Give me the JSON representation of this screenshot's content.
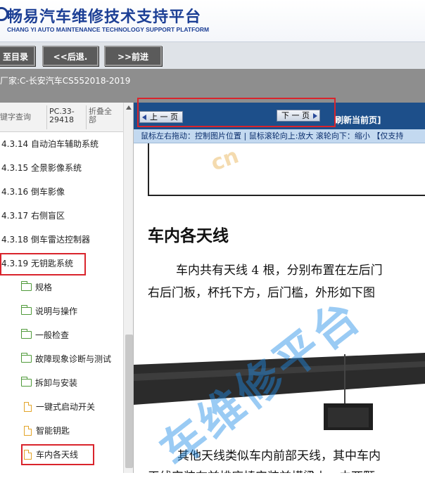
{
  "header": {
    "title": "畅易汽车维修技术支持平台",
    "subtitle": "CHANG YI AUTO MAINTENANCE TECHNOLOGY SUPPORT PLATFORM"
  },
  "nav": {
    "catalog_label": "至目录",
    "back_label": "<<后退.",
    "forward_label": ">>前进"
  },
  "manufacturer_bar": {
    "text": "厂家:C-长安汽车CS552018-2019"
  },
  "sidebar": {
    "columns": [
      "键字查询",
      "PC.33-29418",
      "折叠全部"
    ],
    "items": [
      {
        "label": "4.3.14 自动泊车辅助系统",
        "icon": "none"
      },
      {
        "label": "4.3.15 全景影像系统",
        "icon": "none"
      },
      {
        "label": "4.3.16 倒车影像",
        "icon": "none"
      },
      {
        "label": "4.3.17 右侧盲区",
        "icon": "none"
      },
      {
        "label": "4.3.18 倒车雷达控制器",
        "icon": "none"
      },
      {
        "label": "4.3.19 无钥匙系统",
        "icon": "none",
        "highlighted": true
      },
      {
        "label": "规格",
        "icon": "folder-icon"
      },
      {
        "label": "说明与操作",
        "icon": "folder-icon"
      },
      {
        "label": "一般检查",
        "icon": "folder-icon"
      },
      {
        "label": "故障现象诊断与测试",
        "icon": "folder-icon"
      },
      {
        "label": "拆卸与安装",
        "icon": "folder-open-icon"
      },
      {
        "label": "一键式启动开关",
        "icon": "document-icon"
      },
      {
        "label": "智能钥匙",
        "icon": "document-icon"
      },
      {
        "label": "车内各天线",
        "icon": "document-icon",
        "highlighted": true
      }
    ]
  },
  "viewer": {
    "prev_label": "上 一 页",
    "next_label": "下 一 页",
    "refresh_label": "刷新当前页]",
    "hint": "鼠标左右拖动：控制图片位置 | 鼠标滚轮向上:放大  滚轮向下：缩小 【仅支持",
    "heading": "车内各天线",
    "para1_line1": "车内共有天线 4 根，分别布置在左后门",
    "para1_line2": "右后门板，杯托下方，后门槛，外形如下图",
    "para2_line1": "其他天线类似车内前部天线，其中车内",
    "para2_line2": "天线安装在前排座椅安装前横梁上，由两颗",
    "watermark": "车维修平台",
    "watermark_small": "cn"
  },
  "colors": {
    "brand_blue": "#1c3f95",
    "toolbar_blue": "#1d4f8a",
    "highlight_red": "#d9242c",
    "folder_green": "#4f9a3a",
    "document_orange": "#e3a52a"
  }
}
